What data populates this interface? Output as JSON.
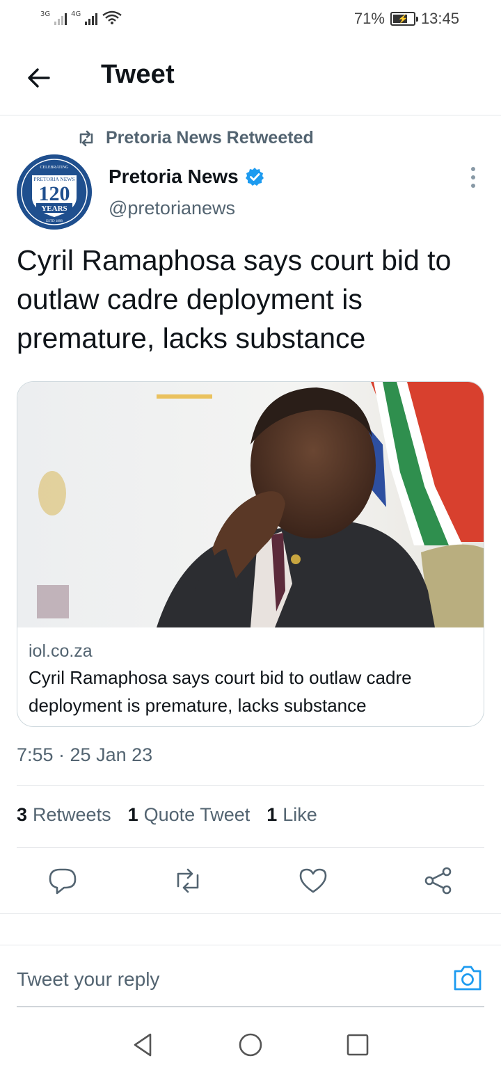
{
  "status_bar": {
    "network1": "3G",
    "network2": "4G",
    "battery_percent": "71%",
    "battery_level": 0.71,
    "time": "13:45"
  },
  "header": {
    "title": "Tweet"
  },
  "retweet_notice": {
    "text": "Pretoria News Retweeted"
  },
  "author": {
    "name": "Pretoria News",
    "handle": "@pretorianews",
    "avatar_text": {
      "top": "CELEBRATING",
      "brand": "PRETORIA NEWS",
      "number": "120",
      "years": "YEARS",
      "est": "ESTD 1898"
    }
  },
  "tweet": {
    "text": "Cyril Ramaphosa says court bid to outlaw cadre deployment is premature, lacks substance",
    "timestamp": "7:55 · 25 Jan 23"
  },
  "card": {
    "domain": "iol.co.za",
    "title": "Cyril Ramaphosa says court bid to outlaw cadre deployment is premature, lacks substance"
  },
  "stats": {
    "retweets_count": "3",
    "retweets_label": "Retweets",
    "quotes_count": "1",
    "quotes_label": "Quote Tweet",
    "likes_count": "1",
    "likes_label": "Like"
  },
  "reply": {
    "placeholder": "Tweet your reply"
  },
  "colors": {
    "accent": "#1d9bf0",
    "muted": "#536471",
    "avatar_bg": "#1f4f8e"
  },
  "icons": {
    "back": "arrow-left-icon",
    "retweet": "retweet-icon",
    "verified": "verified-badge-icon",
    "more": "more-vertical-icon",
    "reply": "reply-icon",
    "like": "heart-icon",
    "share": "share-icon",
    "camera": "camera-icon",
    "nav_back": "triangle-back-icon",
    "nav_home": "circle-home-icon",
    "nav_recents": "square-recents-icon"
  }
}
